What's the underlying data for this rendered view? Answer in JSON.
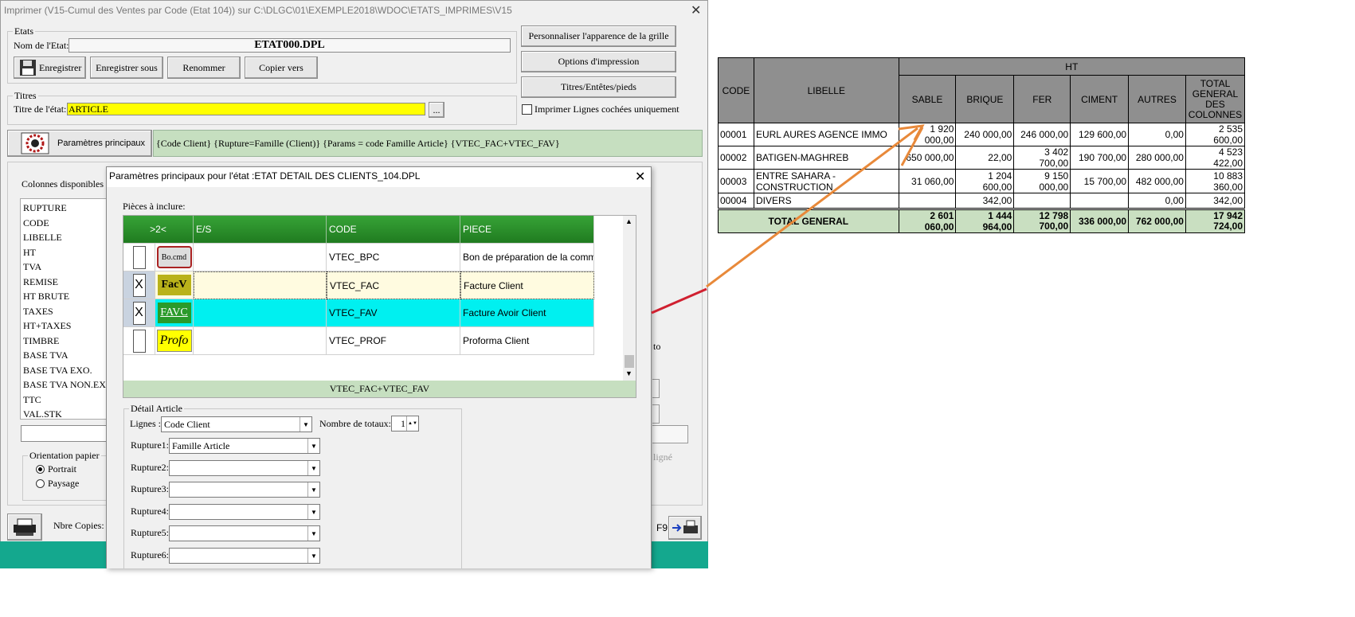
{
  "main_window": {
    "title": "Imprimer (V15-Cumul des Ventes par Code (Etat 104))  sur C:\\DLGC\\01\\EXEMPLE2018\\WDOC\\ETATS_IMPRIMES\\V15",
    "close": "✕",
    "etats": {
      "group_label": "Etats",
      "nom_label": "Nom de l'Etat:",
      "nom_value": "ETAT000.DPL",
      "buttons": [
        "Enregistrer",
        "Enregistrer sous",
        "Renommer",
        "Copier vers"
      ]
    },
    "titres": {
      "group_label": "Titres",
      "titre_label": "Titre de l'état:",
      "titre_value": "ARTICLE",
      "browse": "..."
    },
    "right_buttons": {
      "personnaliser": "Personnaliser l'apparence de la grille",
      "options": "Options d'impression",
      "titres": "Titres/Entêtes/pieds",
      "checkbox_label": "Imprimer Lignes cochées uniquement"
    },
    "params": {
      "button": "Paramètres principaux",
      "summary": "{Code Client} {Rupture=Famille (Client)} {Params = code Famille Article} {VTEC_FAC+VTEC_FAV}"
    },
    "colonnes": {
      "label": "Colonnes disponibles",
      "items": [
        "RUPTURE",
        "CODE",
        "LIBELLE",
        "HT",
        "TVA",
        "REMISE",
        "HT BRUTE",
        "TAXES",
        "HT+TAXES",
        "TIMBRE",
        "BASE TVA",
        "BASE TVA EXO.",
        "BASE TVA NON.EXO",
        "TTC",
        "VAL.STK"
      ]
    },
    "orientation": {
      "label": "Orientation papier",
      "options": [
        "Portrait",
        "Paysage"
      ]
    },
    "copies_label": "Nbre Copies:",
    "f9": "F9",
    "partial_to": "to",
    "partial_ligne": "ligné"
  },
  "dialog": {
    "title": "Paramètres principaux pour l'état :ETAT DETAIL DES CLIENTS_104.DPL",
    "close": "✕",
    "pieces_label": "Pièces à inclure:",
    "grid": {
      "headers": [
        ">2<",
        "E/S",
        "CODE",
        "PIECE"
      ],
      "rows": [
        {
          "checked": "",
          "icon": "Bo.cmd",
          "es": "",
          "code": "VTEC_BPC",
          "piece": "Bon de préparation de la comm"
        },
        {
          "checked": "X",
          "icon": "FacV",
          "es": "",
          "code": "VTEC_FAC",
          "piece": "Facture Client"
        },
        {
          "checked": "X",
          "icon": "FAVC",
          "es": "",
          "code": "VTEC_FAV",
          "piece": "Facture Avoir Client"
        },
        {
          "checked": "",
          "icon": "Profo",
          "es": "",
          "code": "VTEC_PROF",
          "piece": "Proforma Client"
        }
      ],
      "footer": "VTEC_FAC+VTEC_FAV"
    },
    "detail": {
      "group_label": "Détail Article",
      "lignes_label": "Lignes :",
      "lignes_value": "Code Client",
      "nombre_label": "Nombre de totaux:",
      "nombre_value": "1",
      "ruptures": [
        {
          "label": "Rupture1:",
          "value": "Famille Article"
        },
        {
          "label": "Rupture2:",
          "value": ""
        },
        {
          "label": "Rupture3:",
          "value": ""
        },
        {
          "label": "Rupture4:",
          "value": ""
        },
        {
          "label": "Rupture5:",
          "value": ""
        },
        {
          "label": "Rupture6:",
          "value": ""
        }
      ]
    }
  },
  "report": {
    "headers": {
      "code": "CODE",
      "libelle": "LIBELLE",
      "ht": "HT",
      "cols": [
        "SABLE",
        "BRIQUE",
        "FER",
        "CIMENT",
        "AUTRES",
        "TOTAL GENERAL DES COLONNES"
      ]
    },
    "rows": [
      {
        "code": "00001",
        "libelle": "EURL AURES AGENCE IMMO",
        "values": [
          "1 920 000,00",
          "240 000,00",
          "246 000,00",
          "129 600,00",
          "0,00",
          "2 535 600,00"
        ]
      },
      {
        "code": "00002",
        "libelle": "BATIGEN-MAGHREB",
        "values": [
          "650 000,00",
          "22,00",
          "3 402 700,00",
          "190 700,00",
          "280 000,00",
          "4 523 422,00"
        ]
      },
      {
        "code": "00003",
        "libelle": "ENTRE SAHARA - CONSTRUCTION",
        "values": [
          "31 060,00",
          "1 204 600,00",
          "9 150 000,00",
          "15 700,00",
          "482 000,00",
          "10 883 360,00"
        ]
      },
      {
        "code": "00004",
        "libelle": "DIVERS",
        "values": [
          "",
          "342,00",
          "",
          "",
          "0,00",
          "342,00"
        ]
      }
    ],
    "total": {
      "label": "TOTAL GENERAL",
      "values": [
        "2 601 060,00",
        "1 444 964,00",
        "12 798 700,00",
        "336 000,00",
        "762 000,00",
        "17 942 724,00"
      ]
    }
  },
  "colors": {
    "arrow": "#e8893a",
    "red_line": "#d02030",
    "grid_header": "#2e9a2e",
    "highlight_fav": "#00f0f0",
    "title_yellow": "#ffff00"
  }
}
